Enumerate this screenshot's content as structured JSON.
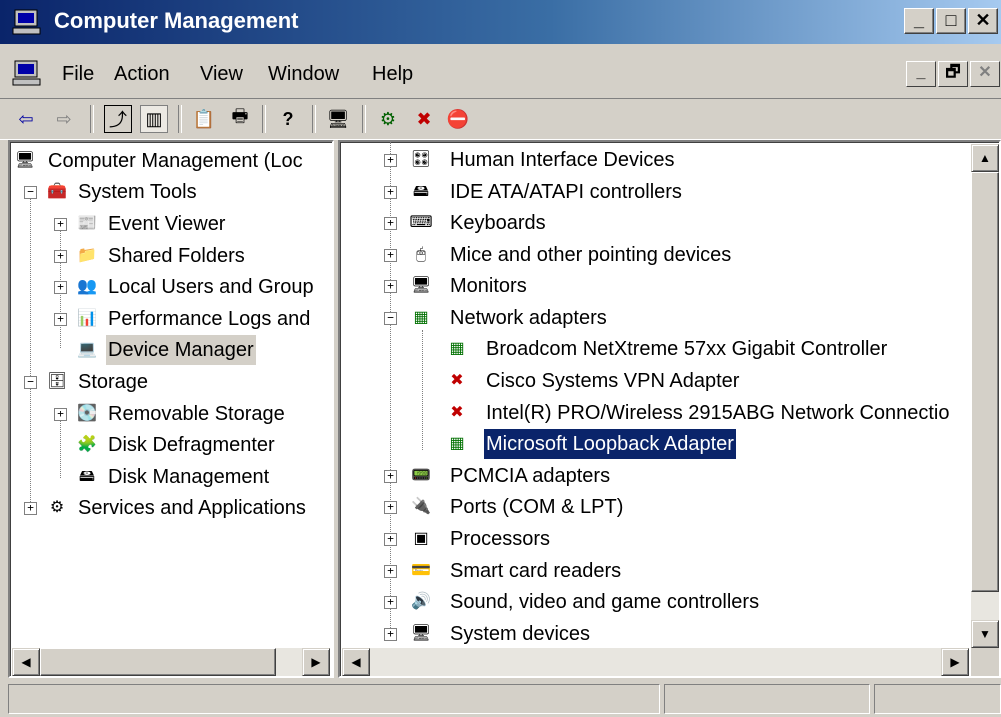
{
  "window": {
    "title": "Computer Management",
    "caption_buttons": [
      "_",
      "□",
      "✕"
    ]
  },
  "menu": {
    "items": [
      {
        "label": "File"
      },
      {
        "label": "Action"
      },
      {
        "label": "View"
      },
      {
        "label": "Window"
      },
      {
        "label": "Help"
      }
    ],
    "mdi_buttons": [
      "_",
      "🗗",
      "✕"
    ]
  },
  "toolbar": {
    "buttons": [
      {
        "icon": "back-arrow-icon",
        "glyph": "⇦"
      },
      {
        "icon": "forward-arrow-icon",
        "glyph": "⇨"
      },
      {
        "icon": "up-folder-icon",
        "glyph": "⤴"
      },
      {
        "icon": "show-hide-tree-icon",
        "glyph": "▥"
      },
      {
        "icon": "properties-icon",
        "glyph": "📋"
      },
      {
        "icon": "print-icon",
        "glyph": "🖶"
      },
      {
        "icon": "help-icon",
        "glyph": "?"
      },
      {
        "icon": "scan-hardware-icon",
        "glyph": "🖥"
      },
      {
        "icon": "update-driver-icon",
        "glyph": "⚙"
      },
      {
        "icon": "uninstall-icon",
        "glyph": "✖"
      },
      {
        "icon": "disable-device-icon",
        "glyph": "⛔"
      }
    ]
  },
  "left_tree": {
    "items": [
      {
        "label": "Computer Management (Loc"
      },
      {
        "label": "System Tools"
      },
      {
        "label": "Event Viewer"
      },
      {
        "label": "Shared Folders"
      },
      {
        "label": "Local Users and Group"
      },
      {
        "label": "Performance Logs and"
      },
      {
        "label": "Device Manager"
      },
      {
        "label": "Storage"
      },
      {
        "label": "Removable Storage"
      },
      {
        "label": "Disk Defragmenter"
      },
      {
        "label": "Disk Management"
      },
      {
        "label": "Services and Applications"
      }
    ]
  },
  "right_tree": {
    "items": [
      {
        "label": "Human Interface Devices"
      },
      {
        "label": "IDE ATA/ATAPI controllers"
      },
      {
        "label": "Keyboards"
      },
      {
        "label": "Mice and other pointing devices"
      },
      {
        "label": "Monitors"
      },
      {
        "label": "Network adapters"
      },
      {
        "label": "Broadcom NetXtreme 57xx Gigabit Controller"
      },
      {
        "label": "Cisco Systems VPN Adapter"
      },
      {
        "label": "Intel(R) PRO/Wireless 2915ABG Network Connectio"
      },
      {
        "label": "Microsoft Loopback Adapter"
      },
      {
        "label": "PCMCIA adapters"
      },
      {
        "label": "Ports (COM & LPT)"
      },
      {
        "label": "Processors"
      },
      {
        "label": "Smart card readers"
      },
      {
        "label": "Sound, video and game controllers"
      },
      {
        "label": "System devices"
      }
    ]
  },
  "expander": {
    "plus": "+",
    "minus": "−"
  },
  "scroll": {
    "up": "▲",
    "down": "▼",
    "left": "◀",
    "right": "▶"
  },
  "colors": {
    "selection": "#0a246a",
    "title_start": "#0a246a",
    "title_end": "#a6caf0",
    "face": "#d4d0c8"
  }
}
